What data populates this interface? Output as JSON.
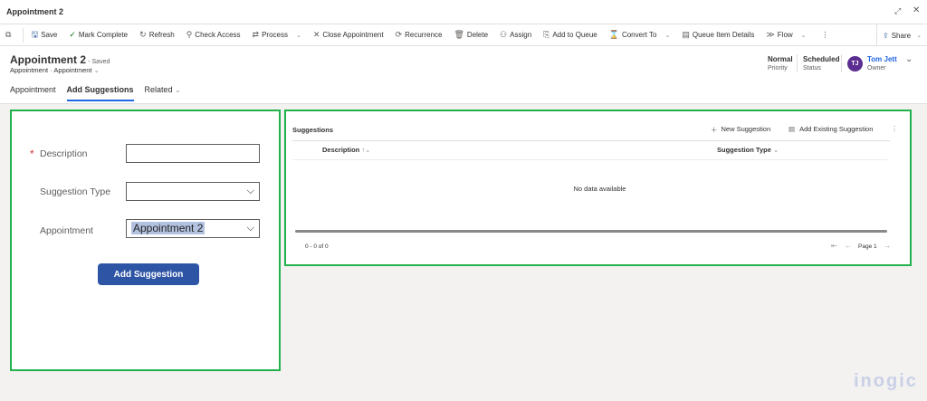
{
  "window": {
    "title": "Appointment 2"
  },
  "toolbar": {
    "items": [
      {
        "label": "Save",
        "icon": "save-icon",
        "glyph": "🖫"
      },
      {
        "label": "Mark Complete",
        "icon": "checkmark-icon",
        "glyph": "✓"
      },
      {
        "label": "Refresh",
        "icon": "refresh-icon",
        "glyph": "↻"
      },
      {
        "label": "Check Access",
        "icon": "key-search-icon",
        "glyph": "⚲"
      },
      {
        "label": "Process",
        "icon": "process-icon",
        "glyph": "⇄",
        "dropdown": true
      },
      {
        "label": "Close Appointment",
        "icon": "close-icon",
        "glyph": "✕"
      },
      {
        "label": "Recurrence",
        "icon": "recurrence-icon",
        "glyph": "⟳"
      },
      {
        "label": "Delete",
        "icon": "trash-icon",
        "glyph": "🗑"
      },
      {
        "label": "Assign",
        "icon": "person-icon",
        "glyph": "⚇"
      },
      {
        "label": "Add to Queue",
        "icon": "queue-icon",
        "glyph": "⎘"
      },
      {
        "label": "Convert To",
        "icon": "convert-icon",
        "glyph": "⌛",
        "dropdown": true
      },
      {
        "label": "Queue Item Details",
        "icon": "details-icon",
        "glyph": "▤"
      },
      {
        "label": "Flow",
        "icon": "flow-icon",
        "glyph": "≫",
        "dropdown": true
      }
    ],
    "share": "Share"
  },
  "header": {
    "title": "Appointment 2",
    "saved": "- Saved",
    "breadcrumb1": "Appointment",
    "breadcrumb2": "Appointment",
    "priority_value": "Normal",
    "priority_label": "Priority",
    "status_value": "Scheduled",
    "status_label": "Status",
    "owner_initials": "TJ",
    "owner_name": "Tom Jett",
    "owner_label": "Owner",
    "avatar_color": "#5c2d91"
  },
  "tabs": [
    {
      "label": "Appointment"
    },
    {
      "label": "Add Suggestions",
      "active": true
    },
    {
      "label": "Related"
    }
  ],
  "form": {
    "required_mark": "*",
    "description_label": "Description",
    "description_value": "",
    "type_label": "Suggestion Type",
    "type_value": "",
    "appointment_label": "Appointment",
    "appointment_value": "Appointment 2",
    "button": "Add Suggestion"
  },
  "grid": {
    "title": "Suggestions",
    "new": "New Suggestion",
    "add_existing": "Add Existing Suggestion",
    "columns": [
      "Description",
      "Suggestion Type"
    ],
    "empty": "No data available",
    "count": "0 - 0 of 0",
    "page": "Page 1"
  },
  "watermark": "inogic"
}
